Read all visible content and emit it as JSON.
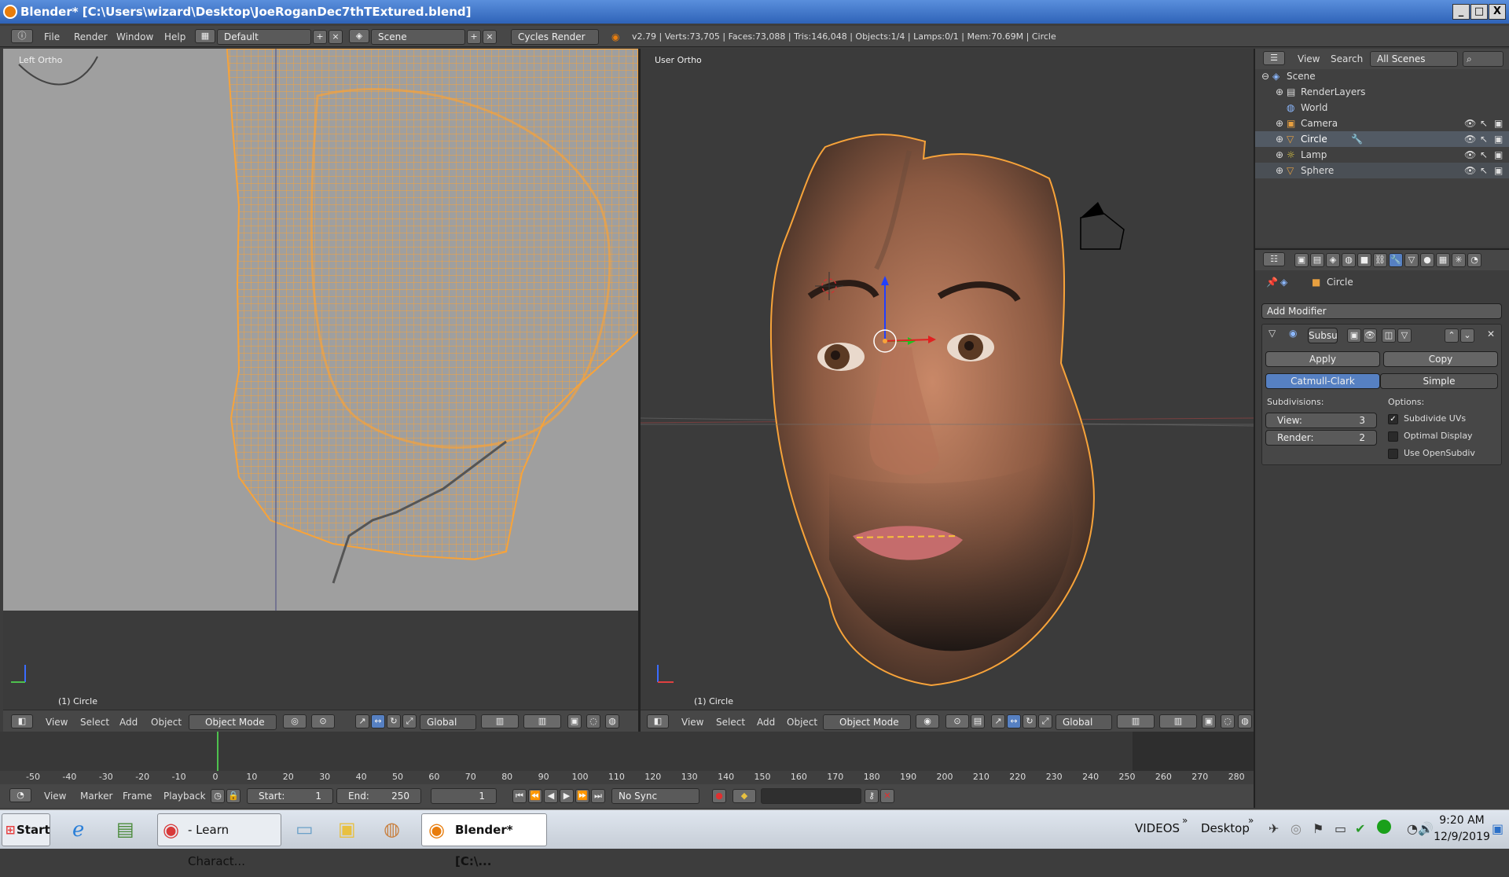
{
  "window": {
    "title": "Blender* [C:\\Users\\wizard\\Desktop\\JoeRoganDec7thTExtured.blend]",
    "controls": [
      "_",
      "□",
      "X"
    ]
  },
  "infobar": {
    "menus": [
      "File",
      "Render",
      "Window",
      "Help"
    ],
    "layout": "Default",
    "scene": "Scene",
    "engine": "Cycles Render",
    "stats": "v2.79 | Verts:73,705 | Faces:73,088 | Tris:146,048 | Objects:1/4 | Lamps:0/1 | Mem:70.69M | Circle"
  },
  "viewport_left": {
    "label": "Left Ortho",
    "object": "(1) Circle",
    "menus": [
      "View",
      "Select",
      "Add",
      "Object"
    ],
    "mode": "Object Mode",
    "orientation": "Global",
    "mesh_color": "#f7a33a"
  },
  "viewport_right": {
    "label": "User Ortho",
    "object": "(1) Circle",
    "menus": [
      "View",
      "Select",
      "Add",
      "Object"
    ],
    "mode": "Object Mode",
    "orientation": "Global"
  },
  "outliner": {
    "menus": [
      "View",
      "Search"
    ],
    "filter": "All Scenes",
    "items": [
      {
        "label": "Scene",
        "icon": "scene-icon"
      },
      {
        "label": "RenderLayers",
        "icon": "renderlayers-icon"
      },
      {
        "label": "World",
        "icon": "world-icon"
      },
      {
        "label": "Camera",
        "icon": "camera-icon"
      },
      {
        "label": "Circle",
        "icon": "mesh-icon"
      },
      {
        "label": "Lamp",
        "icon": "lamp-icon"
      },
      {
        "label": "Sphere",
        "icon": "mesh-icon"
      }
    ]
  },
  "properties": {
    "object": "Circle",
    "add_modifier": "Add Modifier",
    "modifier_name": "Subsu",
    "apply": "Apply",
    "copy": "Copy",
    "type_active": "Catmull-Clark",
    "type_other": "Simple",
    "subdivisions_label": "Subdivisions:",
    "options_label": "Options:",
    "view_label": "View:",
    "view_value": "3",
    "render_label": "Render:",
    "render_value": "2",
    "opt1": "Subdivide UVs",
    "opt2": "Optimal Display",
    "opt3": "Use OpenSubdiv",
    "opt1_checked": true
  },
  "timeline": {
    "ticks": [
      "-50",
      "-40",
      "-30",
      "-20",
      "-10",
      "0",
      "10",
      "20",
      "30",
      "40",
      "50",
      "60",
      "70",
      "80",
      "90",
      "100",
      "110",
      "120",
      "130",
      "140",
      "150",
      "160",
      "170",
      "180",
      "190",
      "200",
      "210",
      "220",
      "230",
      "240",
      "250",
      "260",
      "270",
      "280"
    ],
    "menus": [
      "View",
      "Marker",
      "Frame",
      "Playback"
    ],
    "start_label": "Start:",
    "start_value": "1",
    "end_label": "End:",
    "end_value": "250",
    "current": "1",
    "sync": "No Sync"
  },
  "taskbar": {
    "start": "Start",
    "chrome_label": "- Learn Charact...",
    "blender_label": "Blender* [C:\\...",
    "videos": "VIDEOS",
    "desktop": "Desktop",
    "time": "9:20 AM",
    "date": "12/9/2019"
  }
}
